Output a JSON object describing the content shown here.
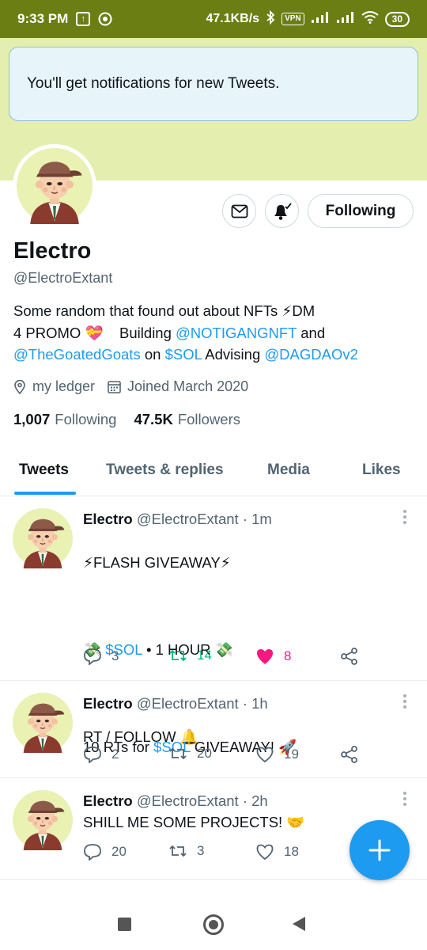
{
  "status": {
    "time": "9:33 PM",
    "speed": "47.1KB/s",
    "vpn": "VPN",
    "battery": "30"
  },
  "toast": {
    "text": "You'll get notifications for new Tweets."
  },
  "profile": {
    "name": "Electro",
    "handle": "@ElectroExtant",
    "bio": {
      "line1_text": "Some random that found out about NFTs ⚡DM",
      "line2_a": "4 PROMO 💝    Building ",
      "line2_link": "@NOTIGANGNFT",
      "line2_b": " and",
      "line3_link1": "@TheGoatedGoats",
      "line3_a": " on ",
      "line3_link2": "$SOL",
      "line3_b": " Advising ",
      "line3_link3": "@DAGDAOv2"
    },
    "location": "my ledger",
    "joined": "Joined March 2020",
    "following_count": "1,007",
    "following_label": "Following",
    "followers_count": "47.5K",
    "followers_label": "Followers",
    "follow_button": "Following"
  },
  "tabs": [
    "Tweets",
    "Tweets & replies",
    "Media",
    "Likes"
  ],
  "tweets": [
    {
      "name": "Electro",
      "handle": "@ElectroExtant",
      "time": "· 1m",
      "line1": "⚡FLASH GIVEAWAY⚡",
      "line2_pre": "💸 ",
      "line2_link": "$SOL",
      "line2_post": " • 1 HOUR 💸",
      "line3": "RT / FOLLOW 🔔",
      "replies": "3",
      "retweets": "14",
      "likes": "8"
    },
    {
      "name": "Electro",
      "handle": "@ElectroExtant",
      "time": "· 1h",
      "text_pre": "10 RTs for ",
      "text_link": "$SOL",
      "text_post": " GIVEAWAY! 🚀",
      "replies": "2",
      "retweets": "20",
      "likes": "19"
    },
    {
      "name": "Electro",
      "handle": "@ElectroExtant",
      "time": "· 2h",
      "text": "SHILL ME SOME PROJECTS! 🤝",
      "replies": "20",
      "retweets": "3",
      "likes": "18"
    }
  ],
  "colors": {
    "accent": "#1d9bf0",
    "retweet_green": "#00ba7c",
    "like_pink": "#f91880",
    "status_bar": "#6b7e14",
    "banner": "#e4eeae"
  },
  "icons": {
    "message": "envelope-icon",
    "notify": "bell-check-icon",
    "location": "location-pin-icon",
    "calendar": "calendar-icon",
    "reply": "reply-icon",
    "retweet": "retweet-icon",
    "like": "heart-icon",
    "share": "share-icon",
    "compose": "plus-icon"
  }
}
